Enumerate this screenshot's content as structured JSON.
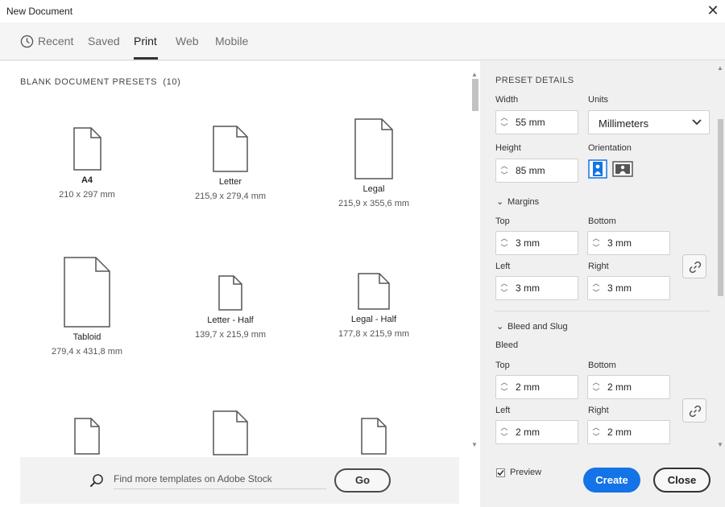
{
  "window": {
    "title": "New Document",
    "close_glyph": "✕"
  },
  "tabs": [
    {
      "label": "Recent",
      "icon": "clock-icon"
    },
    {
      "label": "Saved"
    },
    {
      "label": "Print",
      "active": true
    },
    {
      "label": "Web"
    },
    {
      "label": "Mobile"
    }
  ],
  "presets": {
    "title": "BLANK DOCUMENT PRESETS",
    "count": "(10)",
    "items": [
      {
        "name": "A4",
        "size": "210 x 297 mm",
        "selected": true
      },
      {
        "name": "Letter",
        "size": "215,9 x 279,4 mm"
      },
      {
        "name": "Legal",
        "size": "215,9 x 355,6 mm"
      },
      {
        "name": "Tabloid",
        "size": "279,4 x 431,8 mm"
      },
      {
        "name": "Letter - Half",
        "size": "139,7 x 215,9 mm"
      },
      {
        "name": "Legal - Half",
        "size": "177,8 x 215,9 mm"
      },
      {
        "name": "",
        "size": ""
      },
      {
        "name": "",
        "size": ""
      },
      {
        "name": "",
        "size": ""
      }
    ]
  },
  "search": {
    "placeholder": "Find more templates on Adobe Stock",
    "go_label": "Go"
  },
  "details": {
    "heading": "PRESET DETAILS",
    "width_label": "Width",
    "width_value": "55 mm",
    "units_label": "Units",
    "units_value": "Millimeters",
    "height_label": "Height",
    "height_value": "85 mm",
    "orientation_label": "Orientation",
    "orientation_selected": "portrait",
    "margins": {
      "label": "Margins",
      "top_label": "Top",
      "top": "3 mm",
      "bottom_label": "Bottom",
      "bottom": "3 mm",
      "left_label": "Left",
      "left": "3 mm",
      "right_label": "Right",
      "right": "3 mm"
    },
    "bleed_slug": {
      "label": "Bleed and Slug",
      "bleed_label": "Bleed",
      "top_label": "Top",
      "top": "2 mm",
      "bottom_label": "Bottom",
      "bottom": "2 mm",
      "left_label": "Left",
      "left": "2 mm",
      "right_label": "Right",
      "right": "2 mm"
    }
  },
  "footer": {
    "preview_label": "Preview",
    "preview_checked": true,
    "create_label": "Create",
    "close_label": "Close"
  },
  "colors": {
    "accent": "#1473e6",
    "orientation_active": "#1473e6"
  }
}
